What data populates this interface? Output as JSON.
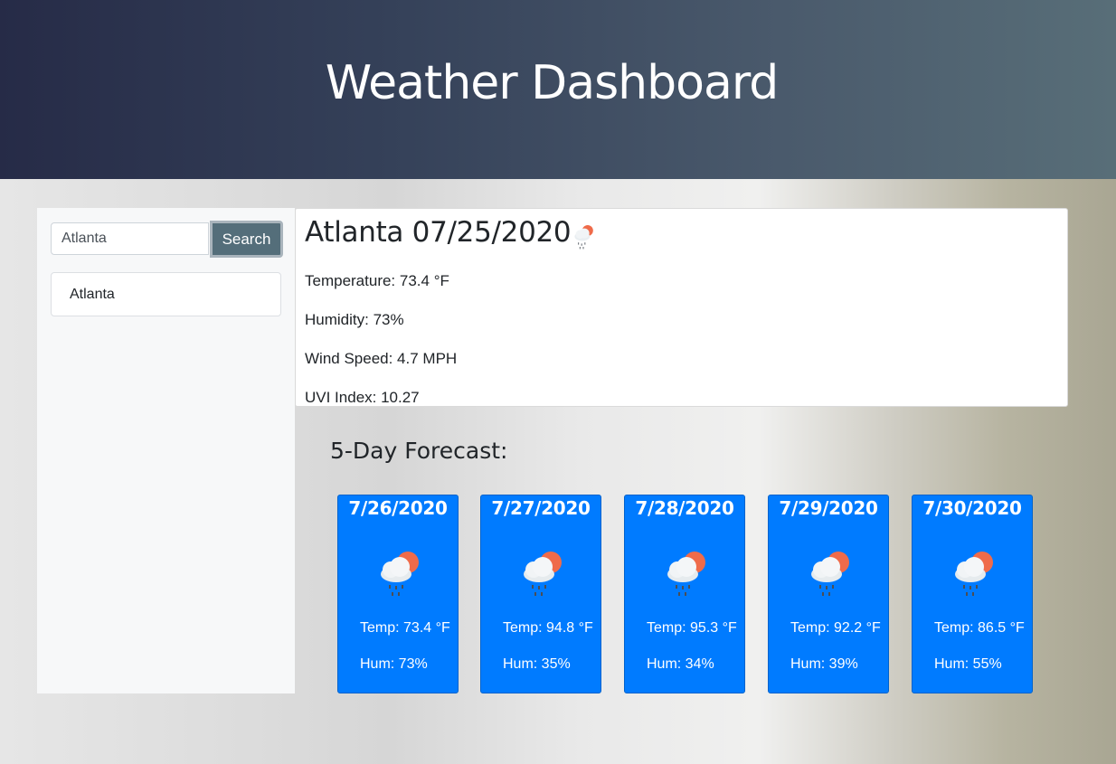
{
  "header": {
    "title": "Weather Dashboard"
  },
  "search": {
    "value": "Atlanta",
    "button_label": "Search"
  },
  "history": [
    {
      "label": "Atlanta"
    }
  ],
  "current": {
    "title": "Atlanta 07/25/2020",
    "icon": "light-rain-sun-icon",
    "temperature": "Temperature: 73.4 °F",
    "humidity": "Humidity: 73%",
    "wind": "Wind Speed: 4.7 MPH",
    "uvi": "UVI Index: 10.27"
  },
  "forecast": {
    "heading": "5-Day Forecast:",
    "days": [
      {
        "date": "7/26/2020",
        "temp": "Temp: 73.4 °F",
        "hum": "Hum: 73%",
        "icon": "light-rain-sun-icon"
      },
      {
        "date": "7/27/2020",
        "temp": "Temp: 94.8 °F",
        "hum": "Hum: 35%",
        "icon": "light-rain-sun-icon"
      },
      {
        "date": "7/28/2020",
        "temp": "Temp: 95.3 °F",
        "hum": "Hum: 34%",
        "icon": "light-rain-sun-icon"
      },
      {
        "date": "7/29/2020",
        "temp": "Temp: 92.2 °F",
        "hum": "Hum: 39%",
        "icon": "light-rain-sun-icon"
      },
      {
        "date": "7/30/2020",
        "temp": "Temp: 86.5 °F",
        "hum": "Hum: 55%",
        "icon": "light-rain-sun-icon"
      }
    ]
  },
  "colors": {
    "card": "#007bff",
    "button": "#546e7a",
    "header_start": "#262b47",
    "header_end": "#586e78"
  }
}
